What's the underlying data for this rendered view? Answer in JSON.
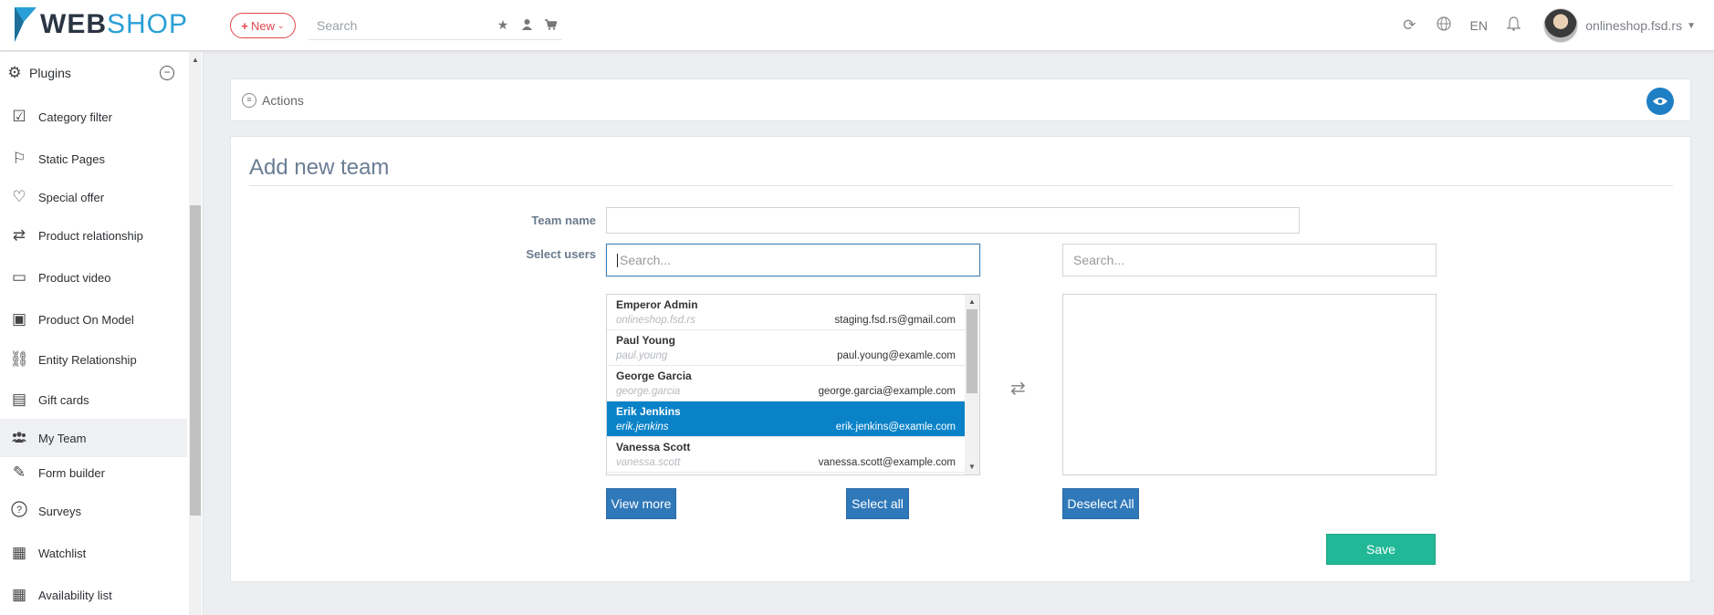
{
  "app": {
    "logo_web": "WEB",
    "logo_shop": "SHOP",
    "new_button": "New",
    "search_placeholder": "Search",
    "language": "EN",
    "user_name": "onlineshop.fsd.rs"
  },
  "sidebar": {
    "header": "Plugins",
    "items": [
      {
        "label": "Category filter",
        "icon": "category-filter-icon"
      },
      {
        "label": "Static Pages",
        "icon": "bookmark-icon"
      },
      {
        "label": "Special offer",
        "icon": "heart-icon"
      },
      {
        "label": "Product relationship",
        "icon": "shuffle-icon"
      },
      {
        "label": "Product video",
        "icon": "video-icon"
      },
      {
        "label": "Product On Model",
        "icon": "image-icon"
      },
      {
        "label": "Entity Relationship",
        "icon": "link-icon"
      },
      {
        "label": "Gift cards",
        "icon": "gift-icon"
      },
      {
        "label": "My Team",
        "icon": "users-icon"
      },
      {
        "label": "Form builder",
        "icon": "wand-icon"
      },
      {
        "label": "Surveys",
        "icon": "question-icon"
      },
      {
        "label": "Watchlist",
        "icon": "watchlist-icon"
      },
      {
        "label": "Availability list",
        "icon": "availability-icon"
      }
    ]
  },
  "actions": {
    "label": "Actions"
  },
  "form": {
    "title": "Add new team",
    "team_name_label": "Team name",
    "team_name_value": "",
    "select_users_label": "Select users",
    "left_search_placeholder": "Search...",
    "right_search_placeholder": "Search...",
    "users": [
      {
        "name": "Emperor Admin",
        "login": "onlineshop.fsd.rs",
        "email": "staging.fsd.rs@gmail.com",
        "selected": false
      },
      {
        "name": "Paul Young",
        "login": "paul.young",
        "email": "paul.young@examle.com",
        "selected": false
      },
      {
        "name": "George Garcia",
        "login": "george.garcia",
        "email": "george.garcia@example.com",
        "selected": false
      },
      {
        "name": "Erik Jenkins",
        "login": "erik.jenkins",
        "email": "erik.jenkins@examle.com",
        "selected": true
      },
      {
        "name": "Vanessa Scott",
        "login": "vanessa.scott",
        "email": "vanessa.scott@example.com",
        "selected": false
      }
    ],
    "view_more": "View more",
    "select_all": "Select all",
    "deselect_all": "Deselect All",
    "save": "Save"
  },
  "colors": {
    "accent": "#2f78b9",
    "save": "#21b897",
    "selected_row": "#0a82c8",
    "new_button": "#e0454b"
  }
}
